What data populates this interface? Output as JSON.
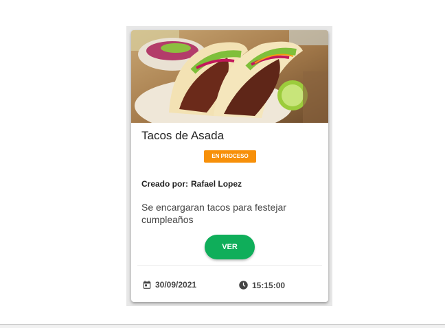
{
  "card": {
    "title": "Tacos de Asada",
    "status": "EN PROCESO",
    "created_by_label": "Creado por:",
    "created_by_name": "Rafael Lopez",
    "description": "Se encargaran tacos para festejar cumpleaños",
    "view_button": "VER",
    "date": "30/09/2021",
    "time": "15:15:00",
    "date_icon": "calendar-icon",
    "time_icon": "clock-icon"
  },
  "colors": {
    "status_badge": "#f79009",
    "view_button": "#0fae5a"
  }
}
